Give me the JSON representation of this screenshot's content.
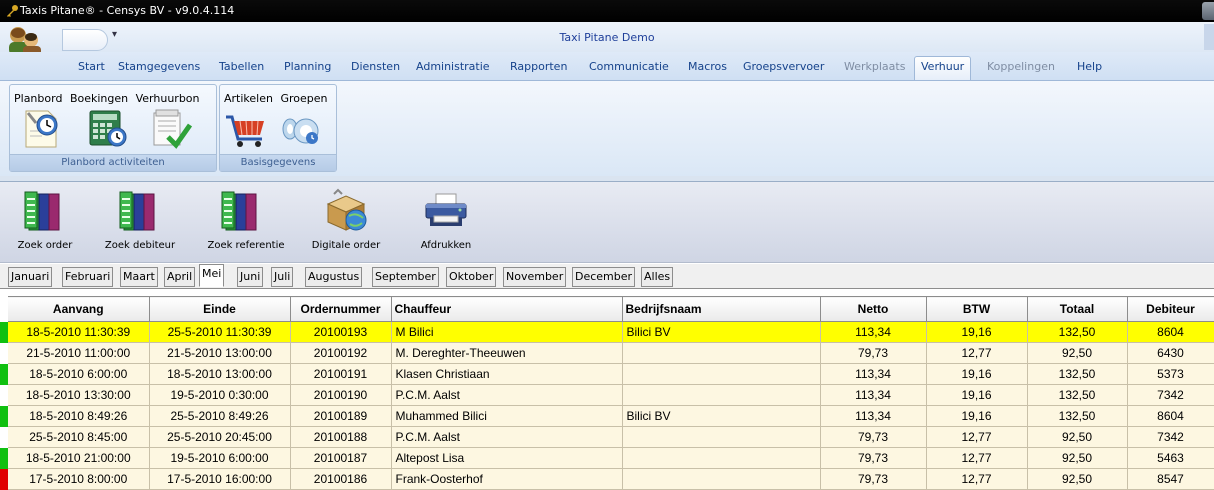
{
  "window": {
    "title": "Taxis Pitane® - Censys BV - v9.0.4.114"
  },
  "app": {
    "title": "Taxi Pitane Demo"
  },
  "menu_tabs": [
    {
      "label": "Start",
      "state": "normal"
    },
    {
      "label": "Stamgegevens",
      "state": "normal"
    },
    {
      "label": "Tabellen",
      "state": "normal"
    },
    {
      "label": "Planning",
      "state": "normal"
    },
    {
      "label": "Diensten",
      "state": "normal"
    },
    {
      "label": "Administratie",
      "state": "normal"
    },
    {
      "label": "Rapporten",
      "state": "normal"
    },
    {
      "label": "Communicatie",
      "state": "normal"
    },
    {
      "label": "Macros",
      "state": "normal"
    },
    {
      "label": "Groepsvervoer",
      "state": "normal"
    },
    {
      "label": "Werkplaats",
      "state": "disabled"
    },
    {
      "label": "Verhuur",
      "state": "active"
    },
    {
      "label": "Koppelingen",
      "state": "disabled"
    },
    {
      "label": "Help",
      "state": "normal"
    }
  ],
  "ribbon": {
    "groups": [
      {
        "label": "Planbord activiteiten",
        "buttons": [
          "Planbord",
          "Boekingen",
          "Verhuurbon"
        ]
      },
      {
        "label": "Basisgegevens",
        "buttons": [
          "Artikelen",
          "Groepen"
        ]
      }
    ]
  },
  "toolbar": {
    "buttons": [
      {
        "label": "Zoek order",
        "icon": "binders-icon"
      },
      {
        "label": "Zoek debiteur",
        "icon": "binders-icon"
      },
      {
        "label": "Zoek referentie",
        "icon": "binders-icon"
      },
      {
        "label": "Digitale order",
        "icon": "box-globe-icon"
      },
      {
        "label": "Afdrukken",
        "icon": "printer-icon"
      }
    ]
  },
  "months": {
    "tabs": [
      "Januari",
      "Februari",
      "Maart",
      "April",
      "Mei",
      "Juni",
      "Juli",
      "Augustus",
      "September",
      "Oktober",
      "November",
      "December",
      "Alles"
    ],
    "active": "Mei"
  },
  "grid": {
    "columns": [
      "Aanvang",
      "Einde",
      "Ordernummer",
      "Chauffeur",
      "Bedrijfsnaam",
      "Netto",
      "BTW",
      "Totaal",
      "Debiteur"
    ],
    "rows": [
      {
        "status": "green",
        "selected": true,
        "cells": [
          "18-5-2010 11:30:39",
          "25-5-2010 11:30:39",
          "20100193",
          "M  Bilici",
          "Bilici BV",
          "113,34",
          "19,16",
          "132,50",
          "8604"
        ]
      },
      {
        "status": "none",
        "selected": false,
        "cells": [
          "21-5-2010 11:00:00",
          "21-5-2010 13:00:00",
          "20100192",
          "M.  Dereghter-Theeuwen",
          "",
          "79,73",
          "12,77",
          "92,50",
          "6430"
        ]
      },
      {
        "status": "green",
        "selected": false,
        "cells": [
          "18-5-2010 6:00:00",
          "18-5-2010 13:00:00",
          "20100191",
          "Klasen Christiaan",
          "",
          "113,34",
          "19,16",
          "132,50",
          "5373"
        ]
      },
      {
        "status": "none",
        "selected": false,
        "cells": [
          "18-5-2010 13:30:00",
          "19-5-2010 0:30:00",
          "20100190",
          "P.C.M.  Aalst",
          "",
          "113,34",
          "19,16",
          "132,50",
          "7342"
        ]
      },
      {
        "status": "green",
        "selected": false,
        "cells": [
          "18-5-2010 8:49:26",
          "25-5-2010 8:49:26",
          "20100189",
          "Muhammed Bilici",
          "Bilici BV",
          "113,34",
          "19,16",
          "132,50",
          "8604"
        ]
      },
      {
        "status": "none",
        "selected": false,
        "cells": [
          "25-5-2010 8:45:00",
          "25-5-2010 20:45:00",
          "20100188",
          "P.C.M.  Aalst",
          "",
          "79,73",
          "12,77",
          "92,50",
          "7342"
        ]
      },
      {
        "status": "green",
        "selected": false,
        "cells": [
          "18-5-2010 21:00:00",
          "19-5-2010 6:00:00",
          "20100187",
          "Altepost Lisa",
          "",
          "79,73",
          "12,77",
          "92,50",
          "5463"
        ]
      },
      {
        "status": "red",
        "selected": false,
        "cells": [
          "17-5-2010 8:00:00",
          "17-5-2010 16:00:00",
          "20100186",
          "Frank-Oosterhof",
          "",
          "79,73",
          "12,77",
          "92,50",
          "8547"
        ]
      }
    ]
  },
  "colors": {
    "status_green": "#10c010",
    "status_red": "#e00000",
    "selected_row": "#ffff00",
    "row_background": "#fdf7e1"
  }
}
